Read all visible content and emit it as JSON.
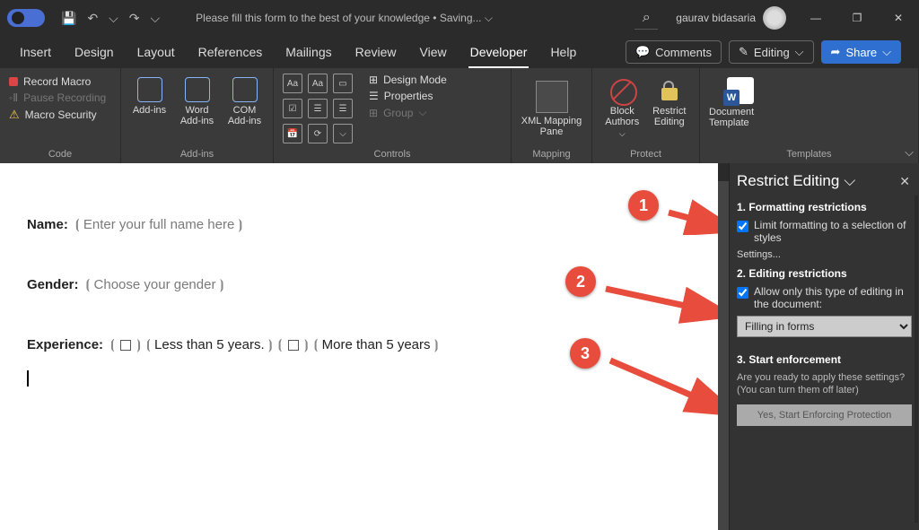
{
  "titlebar": {
    "doc_title": "Please fill this form to the best of your knowledge • Saving...",
    "user_name": "gaurav bidasaria",
    "save_icon": "💾",
    "undo": "↶",
    "redo": "↷",
    "dropdown": "⌵",
    "minimize": "—",
    "restore": "❐",
    "close": "✕",
    "search_icon": "⌕"
  },
  "tabs": {
    "items": [
      "Insert",
      "Design",
      "Layout",
      "References",
      "Mailings",
      "Review",
      "View",
      "Developer",
      "Help"
    ],
    "active": "Developer",
    "comments_label": "Comments",
    "editing_label": "Editing",
    "share_label": "Share"
  },
  "ribbon": {
    "code": {
      "record_macro": "Record Macro",
      "pause_recording": "Pause Recording",
      "macro_security": "Macro Security",
      "label": "Code"
    },
    "addins": {
      "addins": "Add-ins",
      "word_addins": "Word Add-ins",
      "com_addins": "COM Add-ins",
      "label": "Add-ins"
    },
    "controls": {
      "design_mode": "Design Mode",
      "properties": "Properties",
      "group": "Group",
      "label": "Controls",
      "aa1": "Aa",
      "aa2": "Aa"
    },
    "mapping": {
      "xml_pane": "XML Mapping Pane",
      "label": "Mapping"
    },
    "protect": {
      "block_authors": "Block Authors",
      "restrict_editing": "Restrict Editing",
      "label": "Protect"
    },
    "templates": {
      "doc_template": "Document Template",
      "label": "Templates"
    }
  },
  "doc": {
    "name_label": "Name:",
    "name_placeholder": "Enter your full name here",
    "gender_label": "Gender:",
    "gender_placeholder": "Choose your gender",
    "exp_label": "Experience:",
    "exp_less": "Less than 5 years.",
    "exp_more": "More than 5 years"
  },
  "annotations": {
    "n1": "1",
    "n2": "2",
    "n3": "3"
  },
  "pane": {
    "title": "Restrict Editing",
    "section1_title": "1. Formatting restrictions",
    "limit_formatting": "Limit formatting to a selection of styles",
    "settings_link": "Settings...",
    "section2_title": "2. Editing restrictions",
    "allow_only": "Allow only this type of editing in the document:",
    "select_value": "Filling in forms",
    "section3_title": "3. Start enforcement",
    "ready_text": "Are you ready to apply these settings? (You can turn them off later)",
    "enforce_btn": "Yes, Start Enforcing Protection"
  }
}
